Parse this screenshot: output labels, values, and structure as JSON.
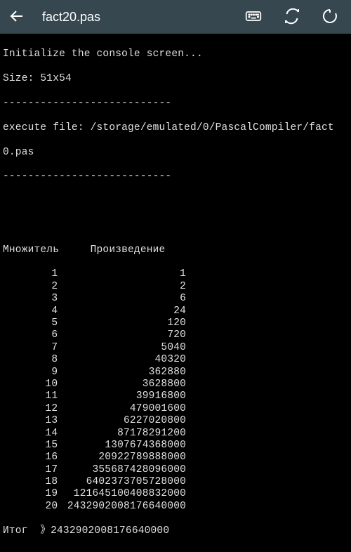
{
  "toolbar": {
    "title": "fact20.pas"
  },
  "console": {
    "init": "Initialize the console screen...",
    "size": "Size: 51x54",
    "sep": "---------------------------",
    "exec1": "execute file: /storage/emulated/0/PascalCompiler/fact",
    "exec2": "0.pas",
    "sep2": "---------------------------",
    "header": "Множитель     Произведение",
    "totalLabel": "Итог  》2432902008176640000"
  },
  "chart_data": {
    "type": "table",
    "title": "",
    "columns": [
      "Множитель",
      "Произведение"
    ],
    "rows": [
      {
        "n": "1",
        "v": "1"
      },
      {
        "n": "2",
        "v": "2"
      },
      {
        "n": "3",
        "v": "6"
      },
      {
        "n": "4",
        "v": "24"
      },
      {
        "n": "5",
        "v": "120"
      },
      {
        "n": "6",
        "v": "720"
      },
      {
        "n": "7",
        "v": "5040"
      },
      {
        "n": "8",
        "v": "40320"
      },
      {
        "n": "9",
        "v": "362880"
      },
      {
        "n": "10",
        "v": "3628800"
      },
      {
        "n": "11",
        "v": "39916800"
      },
      {
        "n": "12",
        "v": "479001600"
      },
      {
        "n": "13",
        "v": "6227020800"
      },
      {
        "n": "14",
        "v": "87178291200"
      },
      {
        "n": "15",
        "v": "1307674368000"
      },
      {
        "n": "16",
        "v": "20922789888000"
      },
      {
        "n": "17",
        "v": "355687428096000"
      },
      {
        "n": "18",
        "v": "6402373705728000"
      },
      {
        "n": "19",
        "v": "121645100408832000"
      },
      {
        "n": "20",
        "v": "2432902008176640000"
      }
    ],
    "total": "2432902008176640000"
  }
}
